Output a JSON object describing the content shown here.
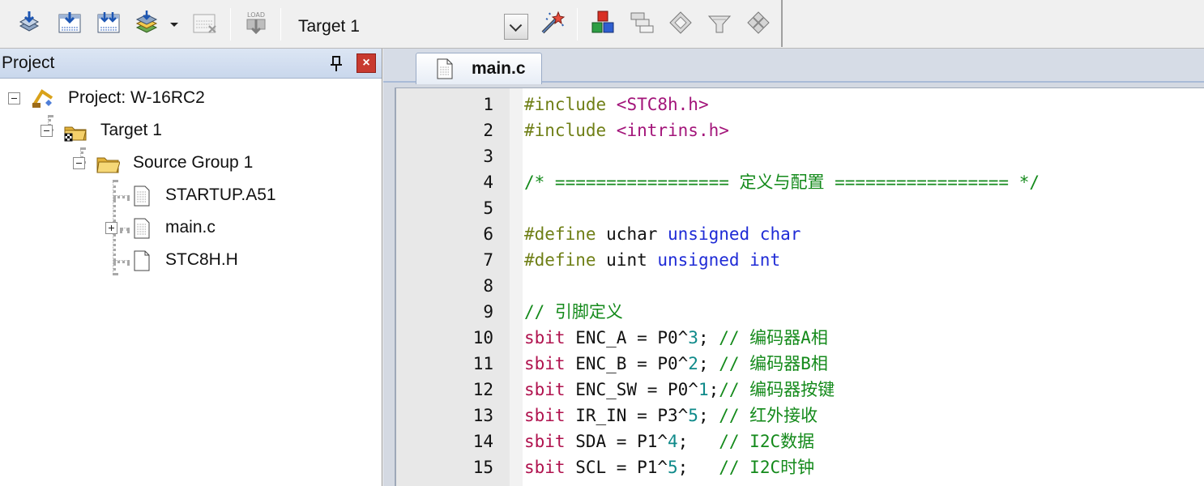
{
  "toolbar": {
    "target_select_value": "Target 1",
    "buttons": [
      {
        "name": "translate-icon"
      },
      {
        "name": "build-icon"
      },
      {
        "name": "rebuild-icon"
      },
      {
        "name": "batch-build-icon"
      },
      {
        "name": "stop-build-icon"
      },
      {
        "name": "download-icon",
        "text": "LOAD"
      },
      {
        "name": "options-wand-icon"
      },
      {
        "name": "manage-components-icon"
      },
      {
        "name": "select-packs-icon"
      },
      {
        "name": "pack-installer-icon"
      },
      {
        "name": "select-software-packs-icon"
      },
      {
        "name": "manage-run-time-icon"
      }
    ]
  },
  "project_panel": {
    "title": "Project",
    "tree": [
      {
        "label": "Project: W-16RC2",
        "icon": "project-icon",
        "expanded": true
      },
      {
        "label": "Target 1",
        "icon": "target-folder-icon",
        "expanded": true
      },
      {
        "label": "Source Group 1",
        "icon": "folder-icon",
        "expanded": true
      },
      {
        "label": "STARTUP.A51",
        "icon": "asm-file-icon"
      },
      {
        "label": "main.c",
        "icon": "c-file-icon",
        "expanded": false
      },
      {
        "label": "STC8H.H",
        "icon": "header-file-icon"
      }
    ]
  },
  "editor": {
    "tab_label": "main.c",
    "lines": [
      {
        "n": "1",
        "tokens": [
          {
            "t": "#include ",
            "c": "pre"
          },
          {
            "t": "<STC8h.h>",
            "c": "inc"
          }
        ]
      },
      {
        "n": "2",
        "tokens": [
          {
            "t": "#include ",
            "c": "pre"
          },
          {
            "t": "<intrins.h>",
            "c": "inc"
          }
        ]
      },
      {
        "n": "3",
        "tokens": []
      },
      {
        "n": "4",
        "tokens": [
          {
            "t": "/* ================= 定义与配置 ================= */",
            "c": "cmt"
          }
        ]
      },
      {
        "n": "5",
        "tokens": []
      },
      {
        "n": "6",
        "tokens": [
          {
            "t": "#define ",
            "c": "pre"
          },
          {
            "t": "uchar ",
            "c": "plain"
          },
          {
            "t": "unsigned char",
            "c": "kw"
          }
        ]
      },
      {
        "n": "7",
        "tokens": [
          {
            "t": "#define ",
            "c": "pre"
          },
          {
            "t": "uint ",
            "c": "plain"
          },
          {
            "t": "unsigned int",
            "c": "kw"
          }
        ]
      },
      {
        "n": "8",
        "tokens": []
      },
      {
        "n": "9",
        "tokens": [
          {
            "t": "// 引脚定义",
            "c": "cmt"
          }
        ]
      },
      {
        "n": "10",
        "tokens": [
          {
            "t": "sbit ",
            "c": "sbit"
          },
          {
            "t": "ENC_A = P0^",
            "c": "plain"
          },
          {
            "t": "3",
            "c": "num"
          },
          {
            "t": "; ",
            "c": "plain"
          },
          {
            "t": "// 编码器A相",
            "c": "cmt"
          }
        ]
      },
      {
        "n": "11",
        "tokens": [
          {
            "t": "sbit ",
            "c": "sbit"
          },
          {
            "t": "ENC_B = P0^",
            "c": "plain"
          },
          {
            "t": "2",
            "c": "num"
          },
          {
            "t": "; ",
            "c": "plain"
          },
          {
            "t": "// 编码器B相",
            "c": "cmt"
          }
        ]
      },
      {
        "n": "12",
        "tokens": [
          {
            "t": "sbit ",
            "c": "sbit"
          },
          {
            "t": "ENC_SW = P0^",
            "c": "plain"
          },
          {
            "t": "1",
            "c": "num"
          },
          {
            "t": ";",
            "c": "plain"
          },
          {
            "t": "// 编码器按键",
            "c": "cmt"
          }
        ]
      },
      {
        "n": "13",
        "tokens": [
          {
            "t": "sbit ",
            "c": "sbit"
          },
          {
            "t": "IR_IN = P3^",
            "c": "plain"
          },
          {
            "t": "5",
            "c": "num"
          },
          {
            "t": "; ",
            "c": "plain"
          },
          {
            "t": "// 红外接收",
            "c": "cmt"
          }
        ]
      },
      {
        "n": "14",
        "tokens": [
          {
            "t": "sbit ",
            "c": "sbit"
          },
          {
            "t": "SDA = P1^",
            "c": "plain"
          },
          {
            "t": "4",
            "c": "num"
          },
          {
            "t": ";   ",
            "c": "plain"
          },
          {
            "t": "// I2C数据",
            "c": "cmt"
          }
        ]
      },
      {
        "n": "15",
        "tokens": [
          {
            "t": "sbit ",
            "c": "sbit"
          },
          {
            "t": "SCL = P1^",
            "c": "plain"
          },
          {
            "t": "5",
            "c": "num"
          },
          {
            "t": ";   ",
            "c": "plain"
          },
          {
            "t": "// I2C时钟",
            "c": "cmt"
          }
        ]
      }
    ]
  }
}
